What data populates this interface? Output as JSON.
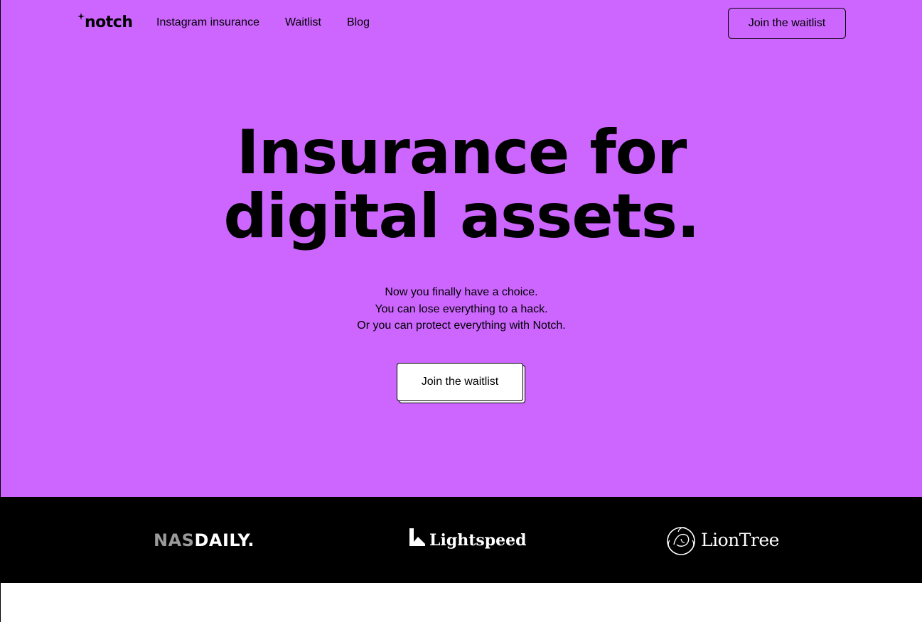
{
  "brand": {
    "logo_text": "notch",
    "hero_bg": "#cc66ff",
    "band_bg": "#000000"
  },
  "nav": {
    "items": [
      "Instagram insurance",
      "Waitlist",
      "Blog"
    ],
    "cta_label": "Join the waitlist"
  },
  "hero": {
    "headline_line1": "Insurance for",
    "headline_line2": "digital assets.",
    "sub_lines": [
      "Now you finally have a choice.",
      "You can lose everything to a hack.",
      "Or you can protect everything with Notch."
    ],
    "cta_label": "Join the waitlist"
  },
  "partners": {
    "nasdaily_a": "NAS",
    "nasdaily_b": "DAILY.",
    "lightspeed": "Lightspeed",
    "liontree": "LionTree"
  },
  "icons": [
    "sparkle-icon",
    "lightspeed-logo-icon",
    "liontree-logo-icon"
  ]
}
